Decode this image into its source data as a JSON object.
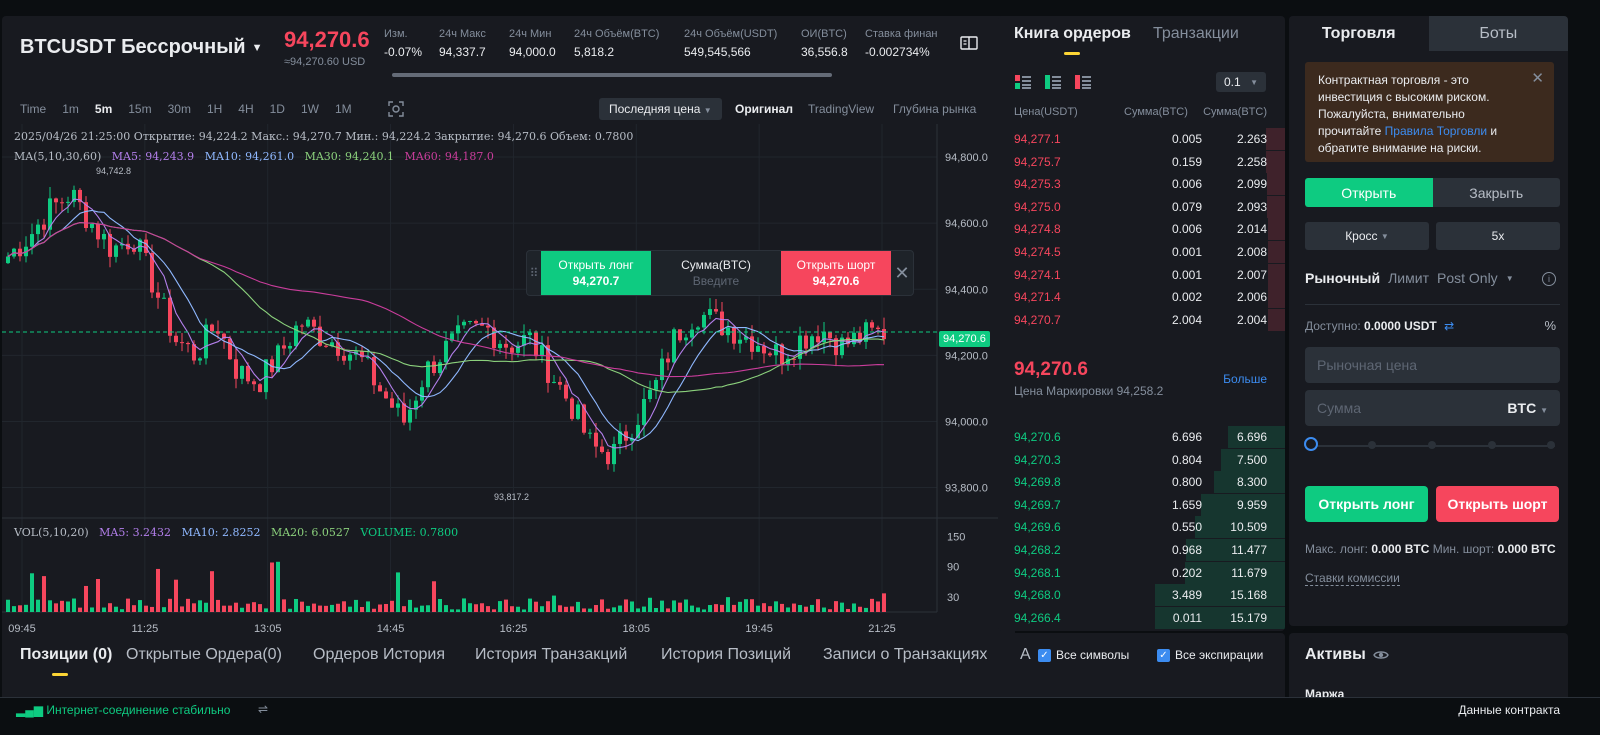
{
  "header": {
    "pair": "BTCUSDT Бессрочный",
    "last_price": "94,270.6",
    "usd_price": "≈94,270.60 USD",
    "stats": [
      {
        "label": "Изм.",
        "value": "-0.07%",
        "color": "#f6465d"
      },
      {
        "label": "24ч Макс",
        "value": "94,337.7"
      },
      {
        "label": "24ч Мин",
        "value": "94,000.0"
      },
      {
        "label": "24ч Объём(BTC)",
        "value": "5,818.2"
      },
      {
        "label": "24ч Объём(USDT)",
        "value": "549,545,566"
      },
      {
        "label": "ОИ(BTC)",
        "value": "36,556.8"
      },
      {
        "label": "Ставка финан",
        "value": "-0.002734%"
      }
    ]
  },
  "toolbar": {
    "timeframes": [
      "Time",
      "1m",
      "5m",
      "15m",
      "30m",
      "1H",
      "4H",
      "1D",
      "1W",
      "1M"
    ],
    "active_timeframe": "5m",
    "price_type": "Последняя цена",
    "views": [
      "Оригинал",
      "TradingView",
      "Глубина рынка"
    ],
    "active_view": "Оригинал"
  },
  "chart_info": {
    "ohlc": "2025/04/26 21:25:00   Открытие: 94,224.2   Макс.: 94,270.7   Мин.: 94,224.2   Закрытие: 94,270.6   Объем: 0.7800",
    "ma_label": "MA(5,10,30,60)",
    "ma5": "MA5: 94,243.9",
    "ma10": "MA10: 94,261.0",
    "ma30": "MA30: 94,240.1",
    "ma60": "MA60: 94,187.0",
    "vol_label": "VOL(5,10,20)",
    "vol_ma5": "MA5: 3.2432",
    "vol_ma10": "MA10: 2.8252",
    "vol_ma20": "MA20: 6.0527",
    "volume": "VOLUME: 0.7800",
    "high_mark": "94,742.8",
    "low_mark": "93,817.2",
    "current_tag": "94,270.6"
  },
  "chart_data": {
    "type": "candlestick",
    "y_ticks": [
      "94,800.0",
      "94,600.0",
      "94,400.0",
      "94,200.0",
      "94,000.0",
      "93,800.0"
    ],
    "y_tick_values": [
      94800,
      94600,
      94400,
      94200,
      94000,
      93800
    ],
    "ylim": [
      93720,
      94900
    ],
    "x_ticks": [
      "09:45",
      "11:25",
      "13:05",
      "14:45",
      "16:25",
      "18:05",
      "19:45",
      "21:25"
    ],
    "vol_ticks": [
      "150",
      "90",
      "30"
    ],
    "vol_tick_values": [
      150,
      90,
      30
    ],
    "vol_ylim": [
      0,
      175
    ],
    "ma_colors": {
      "ma5": "#b37feb",
      "ma10": "#8fb8ff",
      "ma30": "#8bd17c",
      "ma60": "#c93d9b"
    },
    "close_anchors": [
      94500,
      94560,
      94640,
      94690,
      94600,
      94520,
      94560,
      94410,
      94250,
      94200,
      94300,
      94150,
      94120,
      94200,
      94300,
      94260,
      94230,
      94180,
      94080,
      94000,
      94150,
      94220,
      94270,
      94280,
      94230,
      94250,
      94150,
      94050,
      93920,
      93900,
      94000,
      94100,
      94260,
      94330,
      94300,
      94270,
      94240,
      94200,
      94250,
      94280,
      94230,
      94260,
      94270
    ]
  },
  "order_popup": {
    "long_label": "Открыть лонг",
    "long_price": "94,270.7",
    "qty_label": "Сумма(BTC)",
    "qty_placeholder": "Введите",
    "short_label": "Открыть шорт",
    "short_price": "94,270.6"
  },
  "orderbook": {
    "tabs": [
      "Книга ордеров",
      "Транзакции"
    ],
    "precision": "0.1",
    "head": [
      "Цена(USDT)",
      "Сумма(BTC)",
      "Сумма(BTC)"
    ],
    "asks": [
      {
        "price": "94,277.1",
        "size": "0.005",
        "total": "2.263",
        "depth": 0.15
      },
      {
        "price": "94,275.7",
        "size": "0.159",
        "total": "2.258",
        "depth": 0.15
      },
      {
        "price": "94,275.3",
        "size": "0.006",
        "total": "2.099",
        "depth": 0.14
      },
      {
        "price": "94,275.0",
        "size": "0.079",
        "total": "2.093",
        "depth": 0.14
      },
      {
        "price": "94,274.8",
        "size": "0.006",
        "total": "2.014",
        "depth": 0.13
      },
      {
        "price": "94,274.5",
        "size": "0.001",
        "total": "2.008",
        "depth": 0.13
      },
      {
        "price": "94,274.1",
        "size": "0.001",
        "total": "2.007",
        "depth": 0.13
      },
      {
        "price": "94,271.4",
        "size": "0.002",
        "total": "2.006",
        "depth": 0.13
      },
      {
        "price": "94,270.7",
        "size": "2.004",
        "total": "2.004",
        "depth": 0.13
      }
    ],
    "mid_price": "94,270.6",
    "mark_price": "Цена Маркировки 94,258.2",
    "more": "Больше",
    "bids": [
      {
        "price": "94,270.6",
        "size": "6.696",
        "total": "6.696",
        "depth": 0.44
      },
      {
        "price": "94,270.3",
        "size": "0.804",
        "total": "7.500",
        "depth": 0.49
      },
      {
        "price": "94,269.8",
        "size": "0.800",
        "total": "8.300",
        "depth": 0.55
      },
      {
        "price": "94,269.7",
        "size": "1.659",
        "total": "9.959",
        "depth": 0.65
      },
      {
        "price": "94,269.6",
        "size": "0.550",
        "total": "10.509",
        "depth": 0.69
      },
      {
        "price": "94,268.2",
        "size": "0.968",
        "total": "11.477",
        "depth": 0.76
      },
      {
        "price": "94,268.1",
        "size": "0.202",
        "total": "11.679",
        "depth": 0.77
      },
      {
        "price": "94,268.0",
        "size": "3.489",
        "total": "15.168",
        "depth": 1.0
      },
      {
        "price": "94,266.4",
        "size": "0.011",
        "total": "15.179",
        "depth": 1.0
      }
    ]
  },
  "trade": {
    "tabs": [
      "Торговля",
      "Боты"
    ],
    "risk_text_1": "Контрактная торговля - это инвестиция с высоким риском. Пожалуйста, внимательно прочитайте",
    "risk_link": "Правила Торговли",
    "risk_text_2": "и обратите внимание на риски.",
    "open_label": "Открыть",
    "close_label": "Закрыть",
    "margin_mode": "Кросс",
    "leverage": "5x",
    "order_types": [
      "Рыночный",
      "Лимит",
      "Post Only"
    ],
    "available_label": "Доступно:",
    "available_value": "0.0000 USDT",
    "market_price_placeholder": "Рыночная цена",
    "amount_placeholder": "Сумма",
    "amount_unit": "BTC",
    "open_long": "Открыть лонг",
    "open_short": "Открыть шорт",
    "max_long_label": "Макс. лонг:",
    "max_long_value": "0.000 BTC",
    "min_short_label": "Мин. шорт:",
    "min_short_value": "0.000 BTC",
    "fee_link": "Ставки комиссии"
  },
  "positions": {
    "tabs": [
      "Позиции (0)",
      "Открытые Ордера(0)",
      "Ордеров История",
      "История Транзакций",
      "История Позиций",
      "Записи о Транзакциях",
      "А"
    ],
    "all_symbols": "Все символы",
    "all_expiries": "Все экспирации"
  },
  "assets": {
    "title": "Активы",
    "sub": "Маржа"
  },
  "status": {
    "connection": "Интернет-соединение стабильно",
    "contract_data": "Данные контракта"
  }
}
